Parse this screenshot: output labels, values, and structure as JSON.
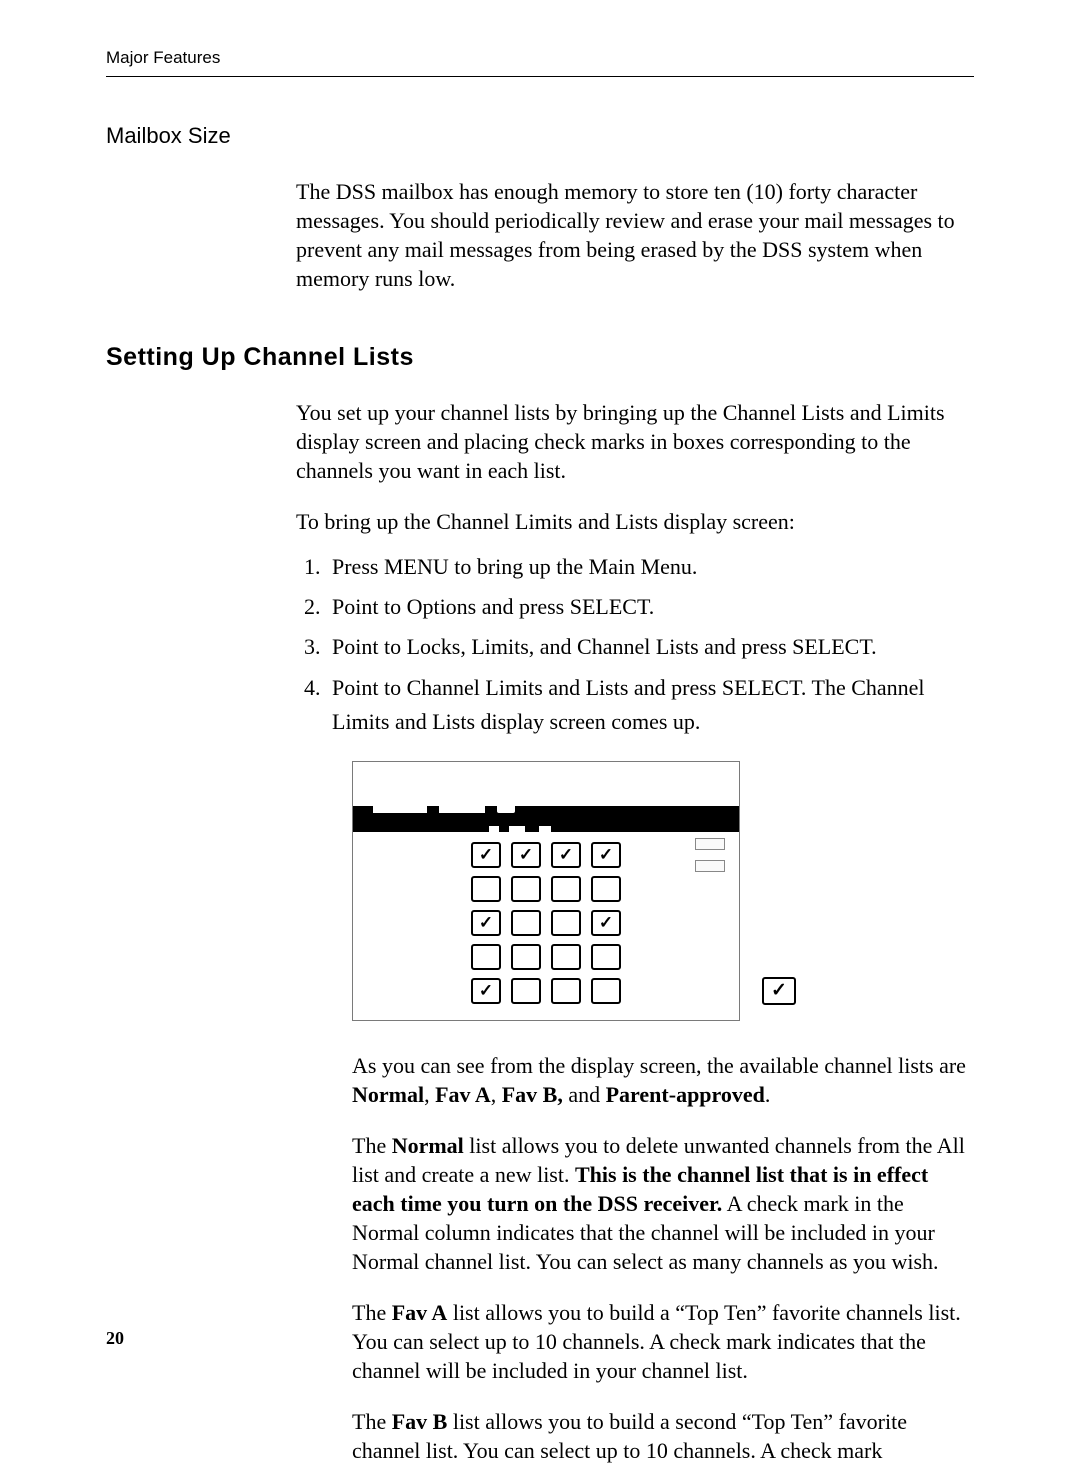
{
  "header": {
    "running": "Major Features"
  },
  "mailbox": {
    "heading": "Mailbox Size",
    "para": "The DSS mailbox has enough memory to store ten (10) forty character messages. You should periodically review and erase your mail messages to prevent any mail messages from being erased by the DSS system when memory runs low."
  },
  "section": {
    "heading": "Setting Up Channel Lists",
    "intro": "You set up your channel lists by bringing up the Channel Lists and Limits display screen and placing check marks in boxes corresponding to the channels you want in each list.",
    "lead": "To bring up the Channel Limits and Lists display screen:",
    "steps": [
      "Press MENU to bring up the Main Menu.",
      "Point to Options and press SELECT.",
      "Point to Locks, Limits, and Channel Lists and press SELECT.",
      "Point to Channel Limits and Lists and press SELECT. The Channel Limits and Lists display screen comes up."
    ],
    "after": {
      "p1a": "As you can see from the display screen, the available channel lists are ",
      "p1b_bold": "Normal",
      "p1c": ", ",
      "p1d_bold": "Fav A",
      "p1e": ", ",
      "p1f_bold": "Fav B,",
      "p1g": " and ",
      "p1h_bold": "Parent-approved",
      "p1i": ".",
      "p2a": "The ",
      "p2b_bold": "Normal",
      "p2c": " list allows you to delete unwanted channels from the All list and create a new list. ",
      "p2d_bold": "This is the channel list that is in effect each time you turn on the DSS receiver.",
      "p2e": " A check mark in the Normal column indicates that the channel will be included in your Normal channel list. You can select as many channels as you wish.",
      "p3a": "The ",
      "p3b_bold": "Fav A",
      "p3c": " list allows you to build a “Top Ten” favorite channels list. You can select up to 10 channels. A check mark indicates that the channel will be included in your channel list.",
      "p4a": "The ",
      "p4b_bold": "Fav B",
      "p4c": " list allows you to build a second “Top Ten” favorite channel list. You can select up to 10 channels. A check mark"
    }
  },
  "figure": {
    "rows": [
      [
        true,
        true,
        true,
        true
      ],
      [
        false,
        false,
        false,
        false
      ],
      [
        true,
        false,
        false,
        true
      ],
      [
        false,
        false,
        false,
        false
      ],
      [
        true,
        false,
        false,
        false
      ]
    ]
  },
  "page_number": "20"
}
